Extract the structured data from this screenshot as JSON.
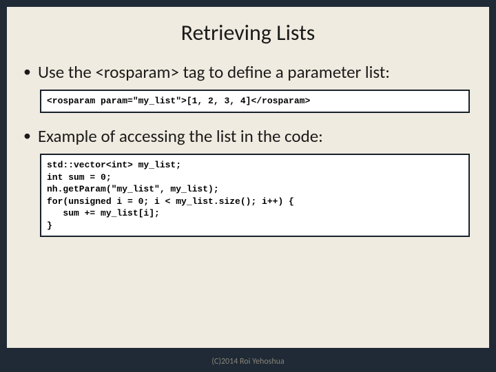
{
  "title": "Retrieving Lists",
  "bullets": {
    "b1": "Use the <rosparam> tag to define a parameter list:",
    "b2": "Example of accessing the list in the code:"
  },
  "code": {
    "box1": "<rosparam param=\"my_list\">[1, 2, 3, 4]</rosparam>",
    "box2": "std::vector<int> my_list;\nint sum = 0;\nnh.getParam(\"my_list\", my_list);\nfor(unsigned i = 0; i < my_list.size(); i++) {\n   sum += my_list[i];\n}"
  },
  "footer": "(C)2014 Roi Yehoshua"
}
